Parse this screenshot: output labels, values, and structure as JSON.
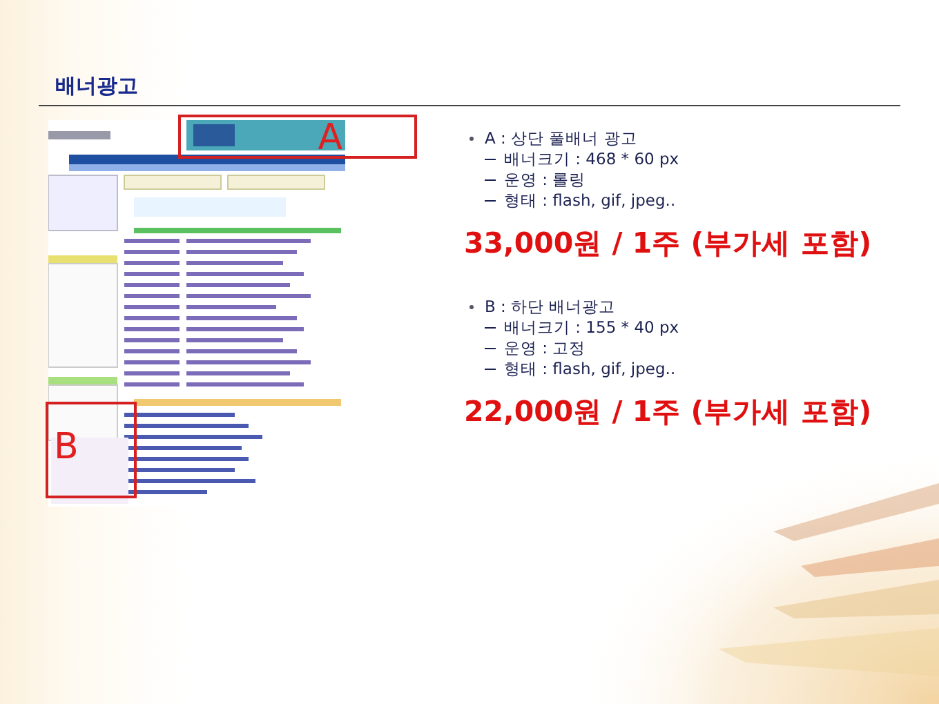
{
  "title": "배너광고",
  "screenshot": {
    "markers": [
      {
        "label": "A",
        "kind": "top"
      },
      {
        "label": "B",
        "kind": "bottom"
      }
    ]
  },
  "ads": [
    {
      "heading": "A : 상단 풀배너 광고",
      "details": [
        "배너크기 : 468 * 60 px",
        "운영 : 롤링",
        "형태 : flash, gif, jpeg.."
      ],
      "price": "33,000원 / 1주 (부가세 포함)"
    },
    {
      "heading": "B : 하단 배너광고",
      "details": [
        "배너크기 : 155 * 40 px",
        "운영 : 고정",
        "형태 : flash, gif, jpeg.."
      ],
      "price": "22,000원 / 1주 (부가세 포함)"
    }
  ]
}
